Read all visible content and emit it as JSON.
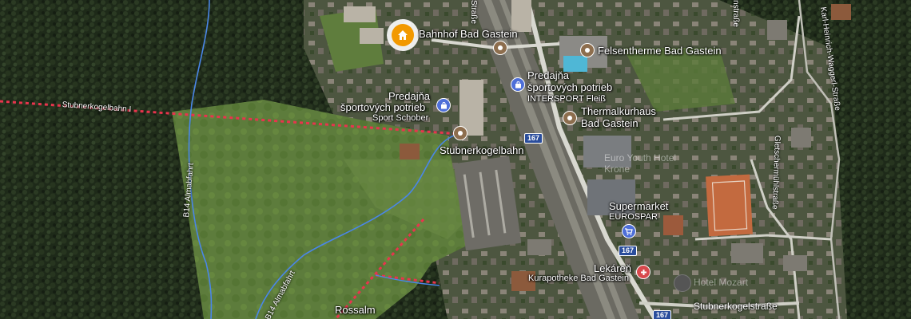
{
  "labels": {
    "bahnhof": "Bahnhof Bad Gastein",
    "felsentherme": "Felsentherme Bad Gastein",
    "intersport_line1": "Predajňa",
    "intersport_line2": "športových potrieb",
    "intersport_line3": "INTERSPORT Fleiß",
    "schober_line1": "Predajňa",
    "schober_line2": "športových potrieb",
    "schober_line3": "Sport Schober",
    "thermalkurhaus_line1": "Thermalkurhaus",
    "thermalkurhaus_line2": "Bad Gastein",
    "stubnerkogelbahn": "Stubnerkogelbahn",
    "euro_youth": "Euro Youth Hotel Krone",
    "supermarket_line1": "Supermarket",
    "supermarket_line2": "EUROSPAR",
    "lekaren_line1": "Lekáreň",
    "lekaren_line2": "Kurapotheke Bad Gastein",
    "rossalm": "Rossalm",
    "lift_line": "Stubnerkogelbahn I",
    "faded_place": "Hotel Mozart"
  },
  "roads": {
    "almabfahrt1": "B14 Almabfahrt",
    "almabfahrt2": "B14 Almabfahrt",
    "karl_heinrich": "Karl-Heinrich-Waggerl-Straße",
    "gletschermuhl": "Gletschermühlstraße",
    "stubnerkogelstrasse": "Stubnerkogelstraße",
    "strasse_top": "Straße",
    "strasse_top_right": "nstraße",
    "route_167a": "167",
    "route_167b": "167",
    "route_167c": "167"
  },
  "icons": {
    "home": "home-icon",
    "attraction": "attraction-icon",
    "shopping": "shopping-bag-icon",
    "grocery": "shopping-cart-icon",
    "pharmacy": "pharmacy-icon"
  },
  "colors": {
    "forest": "#1f2b1a",
    "meadow": "#5b7a3a",
    "poi_brown": "#8d6e4e",
    "shop_blue": "#4e6fd8",
    "pharmacy_red": "#d8494d",
    "home_orange": "#f29900",
    "lift_red": "#e8344d",
    "trail_blue": "#4a86e8"
  }
}
